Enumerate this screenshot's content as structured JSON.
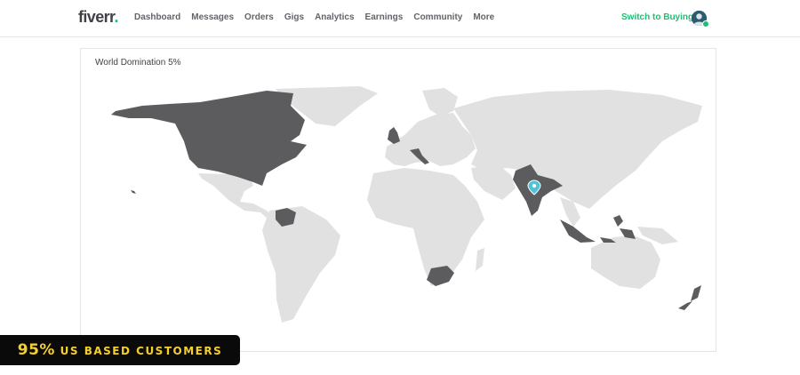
{
  "brand": {
    "logo_text": "fiverr",
    "logo_dot": "."
  },
  "nav": {
    "items": [
      {
        "label": "Dashboard"
      },
      {
        "label": "Messages"
      },
      {
        "label": "Orders"
      },
      {
        "label": "Gigs"
      },
      {
        "label": "Analytics"
      },
      {
        "label": "Earnings"
      },
      {
        "label": "Community"
      },
      {
        "label": "More"
      }
    ],
    "switch_label": "Switch to Buying"
  },
  "user": {
    "avatar_icon": "user-avatar-icon",
    "status": "online"
  },
  "card": {
    "title": "World Domination 5%"
  },
  "map": {
    "base_color": "#e1e1e1",
    "highlight_color": "#5c5c5f",
    "marker_color": "#4fc3d6",
    "highlighted_regions": [
      "United States",
      "Canada",
      "Alaska",
      "Hawaii",
      "United Kingdom",
      "Italy",
      "Venezuela",
      "India",
      "South Africa",
      "Indonesia",
      "Philippines",
      "New Zealand"
    ],
    "marker_icon": "map-pin-icon"
  },
  "banner": {
    "percent": "95%",
    "text": "US BASED CUSTOMERS"
  },
  "colors": {
    "brand_green": "#1dbf73",
    "banner_yellow": "#f5cf2a",
    "banner_bg": "#0a0a0a"
  }
}
